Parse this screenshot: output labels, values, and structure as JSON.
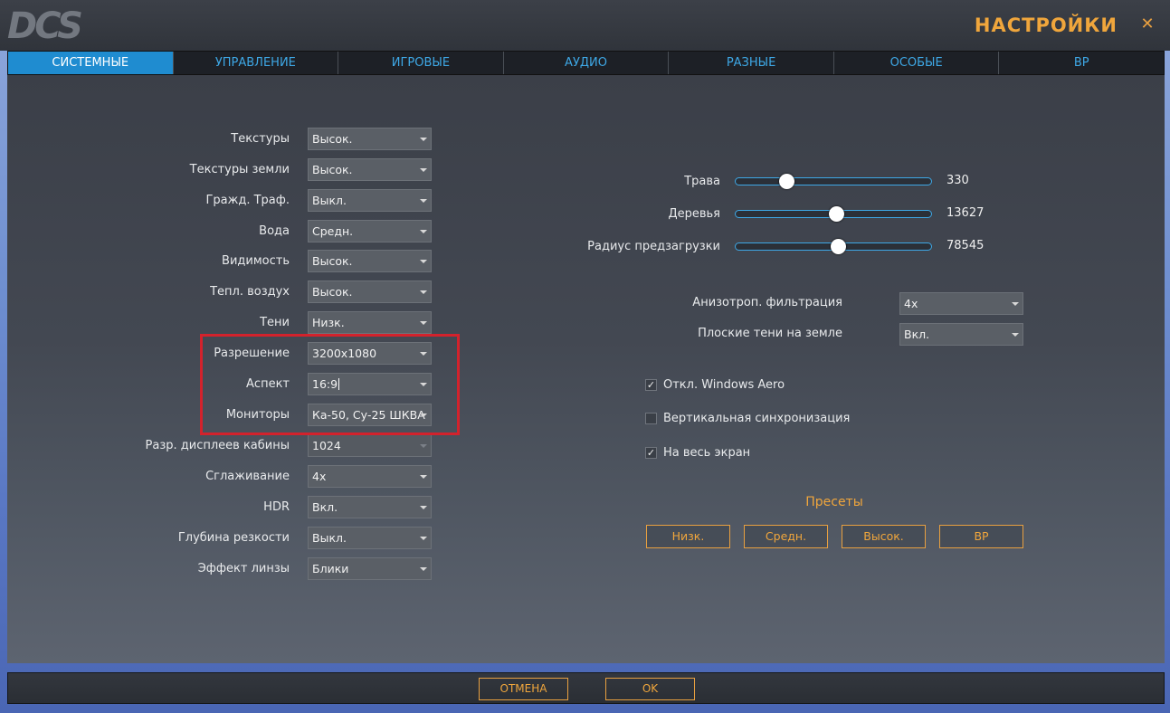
{
  "window": {
    "logo_text": "DCS",
    "title": "НАСТРОЙКИ",
    "close_glyph": "✕"
  },
  "tabs": [
    {
      "label": "СИСТЕМНЫЕ",
      "active": true
    },
    {
      "label": "УПРАВЛЕНИЕ",
      "active": false
    },
    {
      "label": "ИГРОВЫЕ",
      "active": false
    },
    {
      "label": "АУДИО",
      "active": false
    },
    {
      "label": "РАЗНЫЕ",
      "active": false
    },
    {
      "label": "ОСОБЫЕ",
      "active": false
    },
    {
      "label": "ВР",
      "active": false
    }
  ],
  "left_settings": [
    {
      "label": "Текстуры",
      "value": "Высок."
    },
    {
      "label": "Текстуры земли",
      "value": "Высок."
    },
    {
      "label": "Гражд. Траф.",
      "value": "Выкл."
    },
    {
      "label": "Вода",
      "value": "Средн."
    },
    {
      "label": "Видимость",
      "value": "Высок."
    },
    {
      "label": "Тепл. воздух",
      "value": "Высок."
    },
    {
      "label": "Тени",
      "value": "Низк."
    },
    {
      "label": "Разрешение",
      "value": "3200x1080"
    },
    {
      "label": "Аспект",
      "value": "16:9"
    },
    {
      "label": "Мониторы",
      "value": "Ка-50, Су-25 ШКВА"
    },
    {
      "label": "Разр. дисплеев кабины",
      "value": "1024"
    },
    {
      "label": "Сглаживание",
      "value": "4x"
    },
    {
      "label": "HDR",
      "value": "Вкл."
    },
    {
      "label": "Глубина резкости",
      "value": "Выкл."
    },
    {
      "label": "Эффект линзы",
      "value": "Блики"
    }
  ],
  "sliders": [
    {
      "label": "Трава",
      "value": "330",
      "fraction": 0.24
    },
    {
      "label": "Деревья",
      "value": "13627",
      "fraction": 0.51
    },
    {
      "label": "Радиус предзагрузки",
      "value": "78545",
      "fraction": 0.52
    }
  ],
  "right_selects": [
    {
      "label": "Анизотроп. фильтрация",
      "value": "4x"
    },
    {
      "label": "Плоские тени на земле",
      "value": "Вкл."
    }
  ],
  "checkboxes": [
    {
      "label": "Откл. Windows Aero",
      "checked": true
    },
    {
      "label": "Вертикальная синхронизация",
      "checked": false
    },
    {
      "label": "На весь экран",
      "checked": true
    }
  ],
  "presets": {
    "title": "Пресеты",
    "buttons": [
      "Низк.",
      "Средн.",
      "Высок.",
      "ВР"
    ]
  },
  "footer": {
    "cancel_label": "ОТМЕНА",
    "ok_label": "OK"
  },
  "colors": {
    "accent_orange": "#f0a63c",
    "tab_active": "#1f8cd0",
    "tab_text": "#3ea8e6",
    "highlight_red": "#d3222c"
  }
}
